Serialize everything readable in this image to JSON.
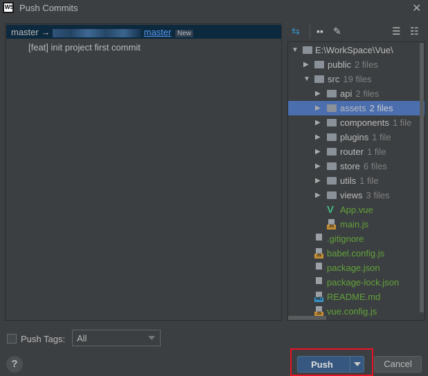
{
  "window": {
    "title": "Push Commits",
    "logo": "WS"
  },
  "left": {
    "branch": {
      "source": "master",
      "arrow": "→",
      "target": "master",
      "badge": "New"
    },
    "commits": [
      "[feat] init project first commit"
    ]
  },
  "toolbar": {
    "icons": [
      "collapse-arrows-icon",
      "group-by-icon",
      "edit-icon",
      "expand-all-icon",
      "collapse-all-icon"
    ]
  },
  "tree": {
    "root": "E:\\WorkSpace\\Vue\\",
    "items": [
      {
        "name": "public",
        "count": "2 files"
      },
      {
        "name": "src",
        "count": "19 files"
      },
      {
        "name": "api",
        "count": "2 files"
      },
      {
        "name": "assets",
        "count": "2 files"
      },
      {
        "name": "components",
        "count": "1 file"
      },
      {
        "name": "plugins",
        "count": "1 file"
      },
      {
        "name": "router",
        "count": "1 file"
      },
      {
        "name": "store",
        "count": "6 files"
      },
      {
        "name": "utils",
        "count": "1 file"
      },
      {
        "name": "views",
        "count": "3 files"
      }
    ],
    "files": [
      "App.vue",
      "main.js",
      ".gitignore",
      "babel.config.js",
      "package.json",
      "package-lock.json",
      "README.md",
      "vue.config.js"
    ],
    "file_labels": {
      "js": "JS",
      "md": "MD"
    }
  },
  "bottom": {
    "push_tags_label": "Push Tags:",
    "push_tags_value": "All",
    "help": "?",
    "push": "Push",
    "cancel": "Cancel"
  },
  "colors": {
    "selection": "#4b6eaf",
    "push": "#365880",
    "highlight": "#e81123",
    "added_file": "#62a23a"
  }
}
